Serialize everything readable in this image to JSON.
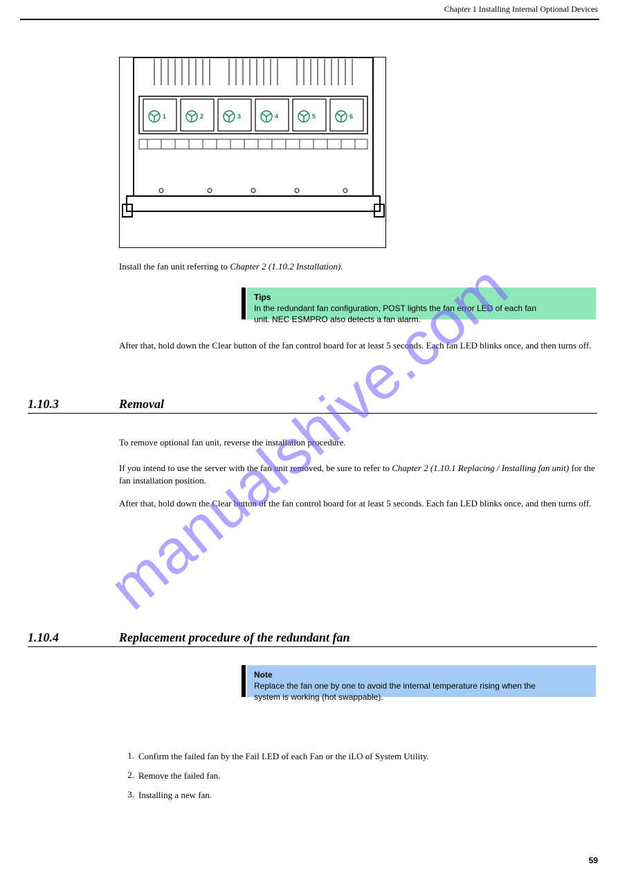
{
  "header": {
    "right": "Chapter 1  Installing Internal Optional Devices"
  },
  "figure": {
    "fan_labels": [
      "1",
      "2",
      "3",
      "4",
      "5",
      "6"
    ]
  },
  "caption_prefix": "Install the fan unit referring to ",
  "caption_xref": "Chapter 2 (1.10.2 Installation).",
  "tip": {
    "label": "Tips",
    "text": "In the redundant fan configuration, POST lights the fan error LED of each fan unit. NEC ESMPRO also detects a fan alarm."
  },
  "tip_after": "After that, hold down the Clear button of the fan control board for at least 5 seconds. Each fan LED blinks once, and then turns off.",
  "section3": {
    "num": "1.10.3",
    "title": "Removal",
    "para1": "To remove optional fan unit, reverse the installation procedure.",
    "para2a": "If you intend to use the server with the fan unit removed, be sure to refer to ",
    "para2xref": "Chapter 2 (1.10.1 Replacing / Installing fan unit)",
    "para2b": " for the fan installation position.",
    "para3": "After that, hold down the Clear button of the fan control board for at least 5 seconds. Each fan LED blinks once, and then turns off."
  },
  "section4": {
    "num": "1.10.4",
    "title": "Replacement procedure of the redundant fan",
    "note": {
      "label": "Note",
      "text": "Replace the fan one by one to avoid the internal temperature rising when the system is working (hot swappable)."
    },
    "items": [
      {
        "n": "1.",
        "text": "Confirm the failed fan by the Fail LED of each Fan or the iLO of System Utility."
      },
      {
        "n": "2.",
        "text": "Remove the failed fan."
      },
      {
        "n": "3.",
        "text": "Installing a new fan."
      }
    ]
  },
  "page_number": "59",
  "watermark": "manualshive.com"
}
